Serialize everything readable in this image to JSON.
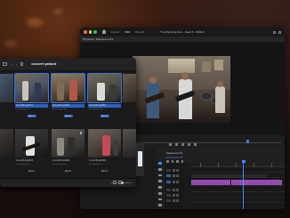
{
  "premiere": {
    "tabs": [
      "Import",
      "Edit",
      "Export"
    ],
    "title": "The Barking Dun - Reel 3 - Edited",
    "program_label": "Program: Sequence 01",
    "current_time": "00:00:00:00",
    "sequence_tab": "Sequence 01",
    "sequence_time": "00:00:01:23",
    "track_labels": [
      "V1",
      "V2",
      "A1",
      "A2",
      "A3"
    ],
    "scrub_position": 0.83
  },
  "finder": {
    "folder_title": "concert gallard",
    "items": [
      {
        "name": "",
        "sub": "",
        "tag": ""
      },
      {
        "name": "ConcertImg.0057",
        "sub": "The Barking Dun",
        "tag": "Report"
      },
      {
        "name": "ConcertImg.0059",
        "sub": "The Barking Dun",
        "tag": "Report"
      },
      {
        "name": "ConcertImg.0061",
        "sub": "The Barking Dun",
        "tag": "Report"
      },
      {
        "name": "",
        "sub": "",
        "tag": ""
      },
      {
        "name": "",
        "sub": "",
        "tag": ""
      },
      {
        "name": "ConcertImg.0063",
        "sub": "The Barking Dun",
        "tag": "Report"
      },
      {
        "name": "ConcertImg.0064",
        "sub": "The Barking Dun",
        "tag": "Report"
      },
      {
        "name": "ConcertImg.0065",
        "sub": "The Barking Dun",
        "tag": "Report"
      },
      {
        "name": "",
        "sub": "",
        "tag": ""
      }
    ]
  },
  "colors": {
    "accent_blue": "#3b8bff",
    "audio_clip": "#8c3fa8",
    "timecode_orange": "#d79a2e"
  }
}
